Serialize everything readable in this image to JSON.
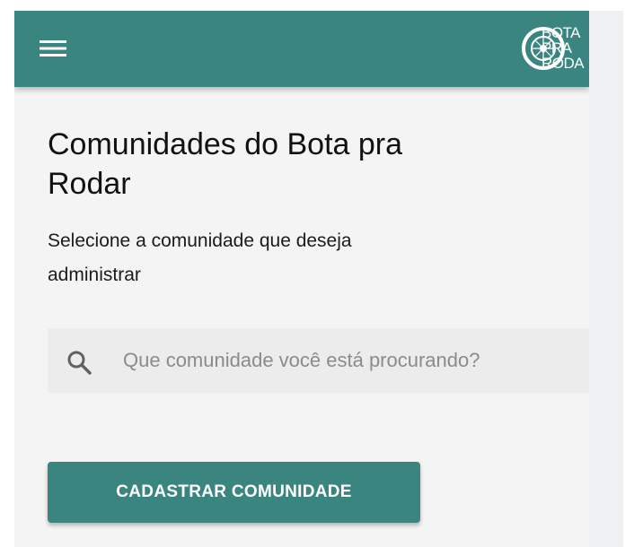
{
  "colors": {
    "primary": "#3b8580",
    "background": "#f4f4f4",
    "search_background": "#ececec",
    "on_primary": "#ffffff"
  },
  "header": {
    "menu_icon": "hamburger-menu-icon",
    "logo": {
      "icon": "wheel-logo-icon",
      "lines": [
        "BOTA",
        "PRA",
        "RODA"
      ]
    }
  },
  "page": {
    "title": "Comunidades do Bota pra Rodar",
    "subtitle": "Selecione a comunidade que deseja administrar"
  },
  "search": {
    "icon": "search-icon",
    "placeholder": "Que comunidade você está procurando?",
    "value": ""
  },
  "actions": {
    "register_label": "CADASTRAR COMUNIDADE"
  }
}
